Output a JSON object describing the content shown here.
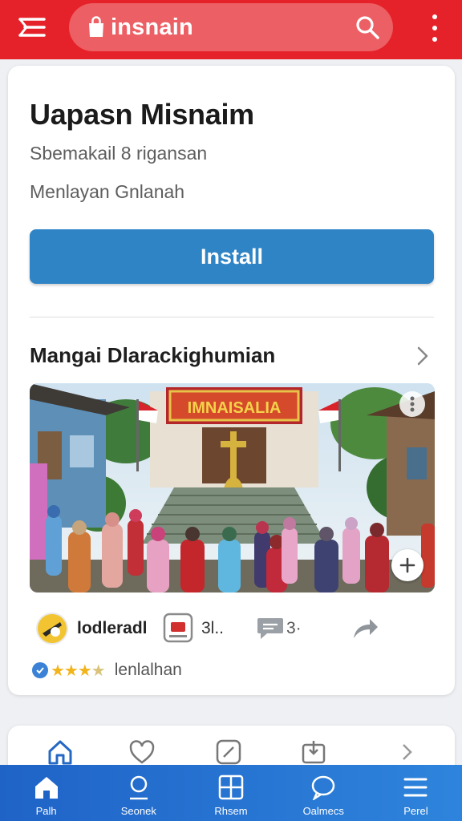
{
  "topbar": {
    "search_query": "insnain",
    "colors": {
      "bar": "#e52229"
    }
  },
  "app": {
    "title": "Uapasn Misnaim",
    "subtitle": "Sbemakail 8 rigansan",
    "category": "Menlayan Gnlanah",
    "install_label": "Install"
  },
  "section": {
    "title": "Mangai Dlarackighumian",
    "banner_text": "IMNAISALIA"
  },
  "stats": {
    "developer": "lodleradl",
    "media_count": "3l..",
    "comment_count": "3·",
    "rating_stars": 3,
    "rating_label": "lenlalhan"
  },
  "bottom_nav": [
    {
      "label": "Palh",
      "icon": "home-icon"
    },
    {
      "label": "Seonek",
      "icon": "search-icon"
    },
    {
      "label": "Rhsem",
      "icon": "grid-icon"
    },
    {
      "label": "Oalmecs",
      "icon": "chat-icon"
    },
    {
      "label": "Perel",
      "icon": "menu-icon"
    }
  ],
  "accent": "#2f84c6"
}
